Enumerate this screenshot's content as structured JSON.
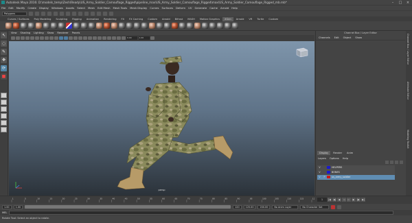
{
  "window": {
    "title": "Autodesk Maya 2016: D:\\models_temp\\Zesh\\Ready\\US_Army_Soldier_Camouflage_Rigged\\pipeline_max\\US_Army_Soldier_Camouflage_Rigged\\max\\US_Army_Soldier_Camouflage_Rigged_mb.mb*"
  },
  "menubar": [
    "File",
    "Edit",
    "Modify",
    "Create",
    "Display",
    "Windows",
    "Assets",
    "Select",
    "Mesh",
    "Edit Mesh",
    "Mesh Tools",
    "Mesh Display",
    "Curves",
    "Surfaces",
    "Deform",
    "UV",
    "Generate",
    "Cache",
    "Arnold",
    "Help"
  ],
  "status": {
    "mode": "Polygons"
  },
  "shelf_tabs": [
    "Curves / Surfaces",
    "Poly Modeling",
    "Sculpting",
    "Rigging",
    "Animation",
    "Rendering",
    "FX",
    "FX Caching",
    "Custom",
    "Arnold",
    "Bifrost",
    "MASH",
    "Motion Graphics",
    "XGen",
    "Arnold",
    "VR",
    "Turtle",
    "Custom"
  ],
  "shelf_active_index": 13,
  "panel_menu": [
    "View",
    "Shading",
    "Lighting",
    "Show",
    "Renderer",
    "Panels"
  ],
  "viewport": {
    "camera": "persp",
    "panel_fields": [
      "0.00",
      "1.00"
    ]
  },
  "channel_box": {
    "title": "Channel Box / Layer Editor",
    "menu": [
      "Channels",
      "Edit",
      "Object",
      "Show"
    ]
  },
  "layer_editor": {
    "tabs": [
      "Display",
      "Render",
      "Anim"
    ],
    "menu": [
      "Layers",
      "Options",
      "Help"
    ],
    "layers": [
      {
        "v": "V",
        "p": "",
        "color": "#1a1acc",
        "name": "HELPERS",
        "selected": false
      },
      {
        "v": "V",
        "p": "",
        "color": "#1a1acc",
        "name": "BONES",
        "selected": false
      },
      {
        "v": "V",
        "p": "P",
        "color": "#cc1a1a",
        "name": "us_army_soldier",
        "selected": true
      }
    ]
  },
  "side_tabs": [
    "Channel Box / Layer Editor",
    "Attribute Editor",
    "Modeling Toolkit"
  ],
  "timeslider": {
    "ticks": [
      "1",
      "5",
      "10",
      "15",
      "20",
      "25",
      "30",
      "35",
      "40",
      "45",
      "50",
      "55",
      "60",
      "65",
      "70",
      "75",
      "80",
      "85",
      "90",
      "95",
      "100",
      "105",
      "110",
      "115",
      "120"
    ],
    "current": "1"
  },
  "range": {
    "start": "1.00",
    "inner_start": "1.00",
    "inner_end": "120",
    "end": "120.00",
    "max": "200.00",
    "anim_layer": "No Anim Layer",
    "char_set": "No Character Set"
  },
  "cmdline": {
    "label": "MEL"
  },
  "helpline": {
    "text": "Rotate Tool: Select an object to rotate."
  }
}
